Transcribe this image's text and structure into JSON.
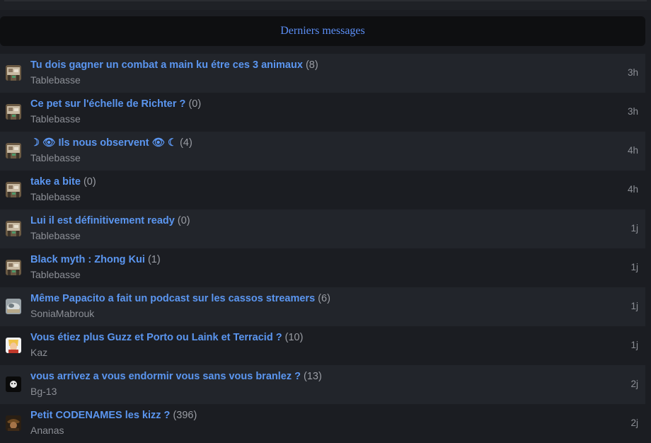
{
  "header": {
    "title": "Derniers messages"
  },
  "rows": [
    {
      "title": "Tu dois gagner un combat a main ku étre ces 3 animaux",
      "count": "(8)",
      "author": "Tablebasse",
      "time": "3h",
      "avatar": "tablebasse-avatar"
    },
    {
      "title": "Ce pet sur l'échelle de Richter ?",
      "count": "(0)",
      "author": "Tablebasse",
      "time": "3h",
      "avatar": "tablebasse-avatar"
    },
    {
      "title": "☽ 👁 Ils nous observent 👁 ☾",
      "count": "(4)",
      "author": "Tablebasse",
      "time": "4h",
      "avatar": "tablebasse-avatar"
    },
    {
      "title": "take a bite",
      "count": "(0)",
      "author": "Tablebasse",
      "time": "4h",
      "avatar": "tablebasse-avatar"
    },
    {
      "title": "Lui il est définitivement ready",
      "count": "(0)",
      "author": "Tablebasse",
      "time": "1j",
      "avatar": "tablebasse-avatar"
    },
    {
      "title": "Black myth : Zhong Kui",
      "count": "(1)",
      "author": "Tablebasse",
      "time": "1j",
      "avatar": "tablebasse-avatar"
    },
    {
      "title": "Même Papacito a fait un podcast sur les cassos streamers",
      "count": "(6)",
      "author": "SoniaMabrouk",
      "time": "1j",
      "avatar": "soniamabrouk-avatar"
    },
    {
      "title": "Vous étiez plus Guzz et Porto ou Laink et Terracid ?",
      "count": "(10)",
      "author": "Kaz",
      "time": "1j",
      "avatar": "kaz-avatar"
    },
    {
      "title": "vous arrivez a vous endormir vous sans vous branlez ?",
      "count": "(13)",
      "author": "Bg-13",
      "time": "2j",
      "avatar": "bg13-avatar"
    },
    {
      "title": "Petit CODENAMES les kizz ?",
      "count": "(396)",
      "author": "Ananas",
      "time": "2j",
      "avatar": "ananas-avatar"
    }
  ]
}
